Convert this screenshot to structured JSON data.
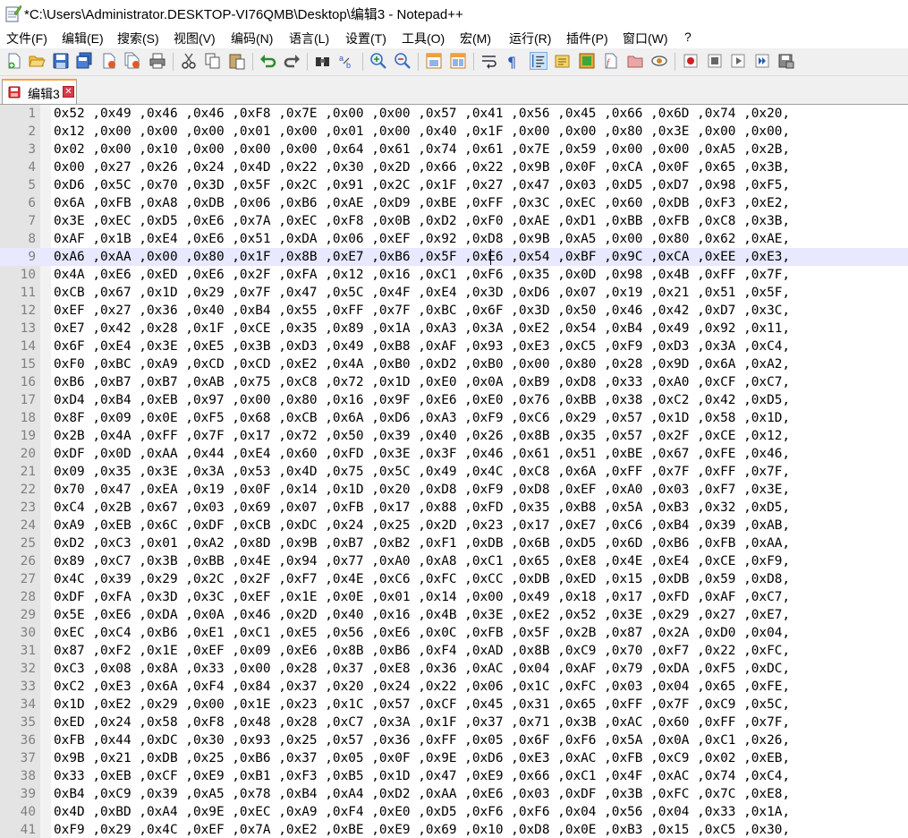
{
  "window": {
    "title": "*C:\\Users\\Administrator.DESKTOP-VI76QMB\\Desktop\\编辑3 - Notepad++"
  },
  "menu": {
    "file": "文件(F)",
    "edit": "编辑(E)",
    "search": "搜索(S)",
    "view": "视图(V)",
    "encoding": "编码(N)",
    "language": "语言(L)",
    "settings": "设置(T)",
    "tools": "工具(O)",
    "macro": "宏(M)",
    "run": "运行(R)",
    "plugins": "插件(P)",
    "window": "窗口(W)",
    "help": "?"
  },
  "toolbar": {
    "icons": [
      "new-file-icon",
      "open-file-icon",
      "save-icon",
      "save-all-icon",
      "close-icon",
      "close-all-icon",
      "print-icon",
      "cut-icon",
      "copy-icon",
      "paste-icon",
      "undo-icon",
      "redo-icon",
      "find-icon",
      "replace-icon",
      "zoom-in-icon",
      "zoom-out-icon",
      "sync-vertical-icon",
      "sync-horizontal-icon",
      "word-wrap-icon",
      "show-all-chars-icon",
      "indent-guide-icon",
      "doc-map-icon",
      "function-list-icon",
      "user-lang-icon",
      "folder-workspace-icon",
      "monitor-icon",
      "record-macro-icon",
      "stop-macro-icon",
      "play-macro-icon",
      "run-macro-multiple-icon",
      "save-macro-icon"
    ]
  },
  "tab": {
    "label": "编辑3",
    "modified": true
  },
  "editor": {
    "current_line": 9,
    "lines": [
      {
        "n": "1",
        "text": "0x52 ,0x49 ,0x46 ,0x46 ,0xF8 ,0x7E ,0x00 ,0x00 ,0x57 ,0x41 ,0x56 ,0x45 ,0x66 ,0x6D ,0x74 ,0x20,"
      },
      {
        "n": "2",
        "text": "0x12 ,0x00 ,0x00 ,0x00 ,0x01 ,0x00 ,0x01 ,0x00 ,0x40 ,0x1F ,0x00 ,0x00 ,0x80 ,0x3E ,0x00 ,0x00,"
      },
      {
        "n": "3",
        "text": "0x02 ,0x00 ,0x10 ,0x00 ,0x00 ,0x00 ,0x64 ,0x61 ,0x74 ,0x61 ,0x7E ,0x59 ,0x00 ,0x00 ,0xA5 ,0x2B,"
      },
      {
        "n": "4",
        "text": "0x00 ,0x27 ,0x26 ,0x24 ,0x4D ,0x22 ,0x30 ,0x2D ,0x66 ,0x22 ,0x9B ,0x0F ,0xCA ,0x0F ,0x65 ,0x3B,"
      },
      {
        "n": "5",
        "text": "0xD6 ,0x5C ,0x70 ,0x3D ,0x5F ,0x2C ,0x91 ,0x2C ,0x1F ,0x27 ,0x47 ,0x03 ,0xD5 ,0xD7 ,0x98 ,0xF5,"
      },
      {
        "n": "6",
        "text": "0x6A ,0xFB ,0xA8 ,0xDB ,0x06 ,0xB6 ,0xAE ,0xD9 ,0xBE ,0xFF ,0x3C ,0xEC ,0x60 ,0xDB ,0xF3 ,0xE2,"
      },
      {
        "n": "7",
        "text": "0x3E ,0xEC ,0xD5 ,0xE6 ,0x7A ,0xEC ,0xF8 ,0x0B ,0xD2 ,0xF0 ,0xAE ,0xD1 ,0xBB ,0xFB ,0xC8 ,0x3B,"
      },
      {
        "n": "8",
        "text": "0xAF ,0x1B ,0xE4 ,0xE6 ,0x51 ,0xDA ,0x06 ,0xEF ,0x92 ,0xD8 ,0x9B ,0xA5 ,0x00 ,0x80 ,0x62 ,0xAE,"
      },
      {
        "n": "9",
        "text": "0xA6 ,0xAA ,0x00 ,0x80 ,0x1F ,0x8B ,0xE7 ,0xB6 ,0x5F ,0xE6 ,0x54 ,0xBF ,0x9C ,0xCA ,0xEE ,0xE3,"
      },
      {
        "n": "10",
        "text": "0x4A ,0xE6 ,0xED ,0xE6 ,0x2F ,0xFA ,0x12 ,0x16 ,0xC1 ,0xF6 ,0x35 ,0x0D ,0x98 ,0x4B ,0xFF ,0x7F,"
      },
      {
        "n": "11",
        "text": "0xCB ,0x67 ,0x1D ,0x29 ,0x7F ,0x47 ,0x5C ,0x4F ,0xE4 ,0x3D ,0xD6 ,0x07 ,0x19 ,0x21 ,0x51 ,0x5F,"
      },
      {
        "n": "12",
        "text": "0xEF ,0x27 ,0x36 ,0x40 ,0xB4 ,0x55 ,0xFF ,0x7F ,0xBC ,0x6F ,0x3D ,0x50 ,0x46 ,0x42 ,0xD7 ,0x3C,"
      },
      {
        "n": "13",
        "text": "0xE7 ,0x42 ,0x28 ,0x1F ,0xCE ,0x35 ,0x89 ,0x1A ,0xA3 ,0x3A ,0xE2 ,0x54 ,0xB4 ,0x49 ,0x92 ,0x11,"
      },
      {
        "n": "14",
        "text": "0x6F ,0xE4 ,0x3E ,0xE5 ,0x3B ,0xD3 ,0x49 ,0xB8 ,0xAF ,0x93 ,0xE3 ,0xC5 ,0xF9 ,0xD3 ,0x3A ,0xC4,"
      },
      {
        "n": "15",
        "text": "0xF0 ,0xBC ,0xA9 ,0xCD ,0xCD ,0xE2 ,0x4A ,0xB0 ,0xD2 ,0xB0 ,0x00 ,0x80 ,0x28 ,0x9D ,0x6A ,0xA2,"
      },
      {
        "n": "16",
        "text": "0xB6 ,0xB7 ,0xB7 ,0xAB ,0x75 ,0xC8 ,0x72 ,0x1D ,0xE0 ,0x0A ,0xB9 ,0xD8 ,0x33 ,0xA0 ,0xCF ,0xC7,"
      },
      {
        "n": "17",
        "text": "0xD4 ,0xB4 ,0xEB ,0x97 ,0x00 ,0x80 ,0x16 ,0x9F ,0xE6 ,0xE0 ,0x76 ,0xBB ,0x38 ,0xC2 ,0x42 ,0xD5,"
      },
      {
        "n": "18",
        "text": "0x8F ,0x09 ,0x0E ,0xF5 ,0x68 ,0xCB ,0x6A ,0xD6 ,0xA3 ,0xF9 ,0xC6 ,0x29 ,0x57 ,0x1D ,0x58 ,0x1D,"
      },
      {
        "n": "19",
        "text": "0x2B ,0x4A ,0xFF ,0x7F ,0x17 ,0x72 ,0x50 ,0x39 ,0x40 ,0x26 ,0x8B ,0x35 ,0x57 ,0x2F ,0xCE ,0x12,"
      },
      {
        "n": "20",
        "text": "0xDF ,0x0D ,0xAA ,0x44 ,0xE4 ,0x60 ,0xFD ,0x3E ,0x3F ,0x46 ,0x61 ,0x51 ,0xBE ,0x67 ,0xFE ,0x46,"
      },
      {
        "n": "21",
        "text": "0x09 ,0x35 ,0x3E ,0x3A ,0x53 ,0x4D ,0x75 ,0x5C ,0x49 ,0x4C ,0xC8 ,0x6A ,0xFF ,0x7F ,0xFF ,0x7F,"
      },
      {
        "n": "22",
        "text": "0x70 ,0x47 ,0xEA ,0x19 ,0x0F ,0x14 ,0x1D ,0x20 ,0xD8 ,0xF9 ,0xD8 ,0xEF ,0xA0 ,0x03 ,0xF7 ,0x3E,"
      },
      {
        "n": "23",
        "text": "0xC4 ,0x2B ,0x67 ,0x03 ,0x69 ,0x07 ,0xFB ,0x17 ,0x88 ,0xFD ,0x35 ,0xB8 ,0x5A ,0xB3 ,0x32 ,0xD5,"
      },
      {
        "n": "24",
        "text": "0xA9 ,0xEB ,0x6C ,0xDF ,0xCB ,0xDC ,0x24 ,0x25 ,0x2D ,0x23 ,0x17 ,0xE7 ,0xC6 ,0xB4 ,0x39 ,0xAB,"
      },
      {
        "n": "25",
        "text": "0xD2 ,0xC3 ,0x01 ,0xA2 ,0x8D ,0x9B ,0xB7 ,0xB2 ,0xF1 ,0xDB ,0x6B ,0xD5 ,0x6D ,0xB6 ,0xFB ,0xAA,"
      },
      {
        "n": "26",
        "text": "0x89 ,0xC7 ,0x3B ,0xBB ,0x4E ,0x94 ,0x77 ,0xA0 ,0xA8 ,0xC1 ,0x65 ,0xE8 ,0x4E ,0xE4 ,0xCE ,0xF9,"
      },
      {
        "n": "27",
        "text": "0x4C ,0x39 ,0x29 ,0x2C ,0x2F ,0xF7 ,0x4E ,0xC6 ,0xFC ,0xCC ,0xDB ,0xED ,0x15 ,0xDB ,0x59 ,0xD8,"
      },
      {
        "n": "28",
        "text": "0xDF ,0xFA ,0x3D ,0x3C ,0xEF ,0x1E ,0x0E ,0x01 ,0x14 ,0x00 ,0x49 ,0x18 ,0x17 ,0xFD ,0xAF ,0xC7,"
      },
      {
        "n": "29",
        "text": "0x5E ,0xE6 ,0xDA ,0x0A ,0x46 ,0x2D ,0x40 ,0x16 ,0x4B ,0x3E ,0xE2 ,0x52 ,0x3E ,0x29 ,0x27 ,0xE7,"
      },
      {
        "n": "30",
        "text": "0xEC ,0xC4 ,0xB6 ,0xE1 ,0xC1 ,0xE5 ,0x56 ,0xE6 ,0x0C ,0xFB ,0x5F ,0x2B ,0x87 ,0x2A ,0xD0 ,0x04,"
      },
      {
        "n": "31",
        "text": "0x87 ,0xF2 ,0x1E ,0xEF ,0x09 ,0xE6 ,0x8B ,0xB6 ,0xF4 ,0xAD ,0x8B ,0xC9 ,0x70 ,0xF7 ,0x22 ,0xFC,"
      },
      {
        "n": "32",
        "text": "0xC3 ,0x08 ,0x8A ,0x33 ,0x00 ,0x28 ,0x37 ,0xE8 ,0x36 ,0xAC ,0x04 ,0xAF ,0x79 ,0xDA ,0xF5 ,0xDC,"
      },
      {
        "n": "33",
        "text": "0xC2 ,0xE3 ,0x6A ,0xF4 ,0x84 ,0x37 ,0x20 ,0x24 ,0x22 ,0x06 ,0x1C ,0xFC ,0x03 ,0x04 ,0x65 ,0xFE,"
      },
      {
        "n": "34",
        "text": "0x1D ,0xE2 ,0x29 ,0x00 ,0x1E ,0x23 ,0x1C ,0x57 ,0xCF ,0x45 ,0x31 ,0x65 ,0xFF ,0x7F ,0xC9 ,0x5C,"
      },
      {
        "n": "35",
        "text": "0xED ,0x24 ,0x58 ,0xF8 ,0x48 ,0x28 ,0xC7 ,0x3A ,0x1F ,0x37 ,0x71 ,0x3B ,0xAC ,0x60 ,0xFF ,0x7F,"
      },
      {
        "n": "36",
        "text": "0xFB ,0x44 ,0xDC ,0x30 ,0x93 ,0x25 ,0x57 ,0x36 ,0xFF ,0x05 ,0x6F ,0xF6 ,0x5A ,0x0A ,0xC1 ,0x26,"
      },
      {
        "n": "37",
        "text": "0x9B ,0x21 ,0xDB ,0x25 ,0xB6 ,0x37 ,0x05 ,0x0F ,0x9E ,0xD6 ,0xE3 ,0xAC ,0xFB ,0xC9 ,0x02 ,0xEB,"
      },
      {
        "n": "38",
        "text": "0x33 ,0xEB ,0xCF ,0xE9 ,0xB1 ,0xF3 ,0xB5 ,0x1D ,0x47 ,0xE9 ,0x66 ,0xC1 ,0x4F ,0xAC ,0x74 ,0xC4,"
      },
      {
        "n": "39",
        "text": "0xB4 ,0xC9 ,0x39 ,0xA5 ,0x78 ,0xB4 ,0xA4 ,0xD2 ,0xAA ,0xE6 ,0x03 ,0xDF ,0x3B ,0xFC ,0x7C ,0xE8,"
      },
      {
        "n": "40",
        "text": "0x4D ,0xBD ,0xA4 ,0x9E ,0xEC ,0xA9 ,0xF4 ,0xE0 ,0xD5 ,0xF6 ,0xF6 ,0x04 ,0x56 ,0x04 ,0x33 ,0x1A,"
      },
      {
        "n": "41",
        "text": "0xF9 ,0x29 ,0x4C ,0xEF ,0x7A ,0xE2 ,0xBE ,0xE9 ,0x69 ,0x10 ,0xD8 ,0x0E ,0xB3 ,0x15 ,0xC5 ,0x30,"
      }
    ]
  }
}
